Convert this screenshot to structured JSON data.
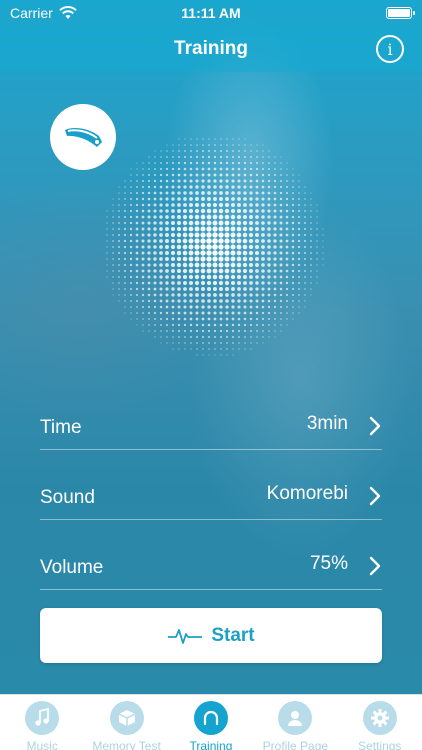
{
  "status_bar": {
    "carrier": "Carrier",
    "time": "11:11 AM"
  },
  "nav": {
    "title": "Training",
    "info_glyph": "i"
  },
  "device_icon": "headband-icon",
  "settings": [
    {
      "label": "Time",
      "value": "3min"
    },
    {
      "label": "Sound",
      "value": "Komorebi"
    },
    {
      "label": "Volume",
      "value": "75%"
    }
  ],
  "start_button": {
    "label": "Start",
    "icon": "heartbeat-icon"
  },
  "tabs": [
    {
      "label": "Music",
      "icon": "music-note-icon",
      "active": false
    },
    {
      "label": "Memory Test",
      "icon": "cube-icon",
      "active": false
    },
    {
      "label": "Training",
      "icon": "headband-icon",
      "active": true
    },
    {
      "label": "Profile Page",
      "icon": "user-icon",
      "active": false
    },
    {
      "label": "Settings",
      "icon": "gear-icon",
      "active": false
    }
  ],
  "colors": {
    "accent": "#15a3cf",
    "tab_inactive": "#a9d3e3"
  }
}
